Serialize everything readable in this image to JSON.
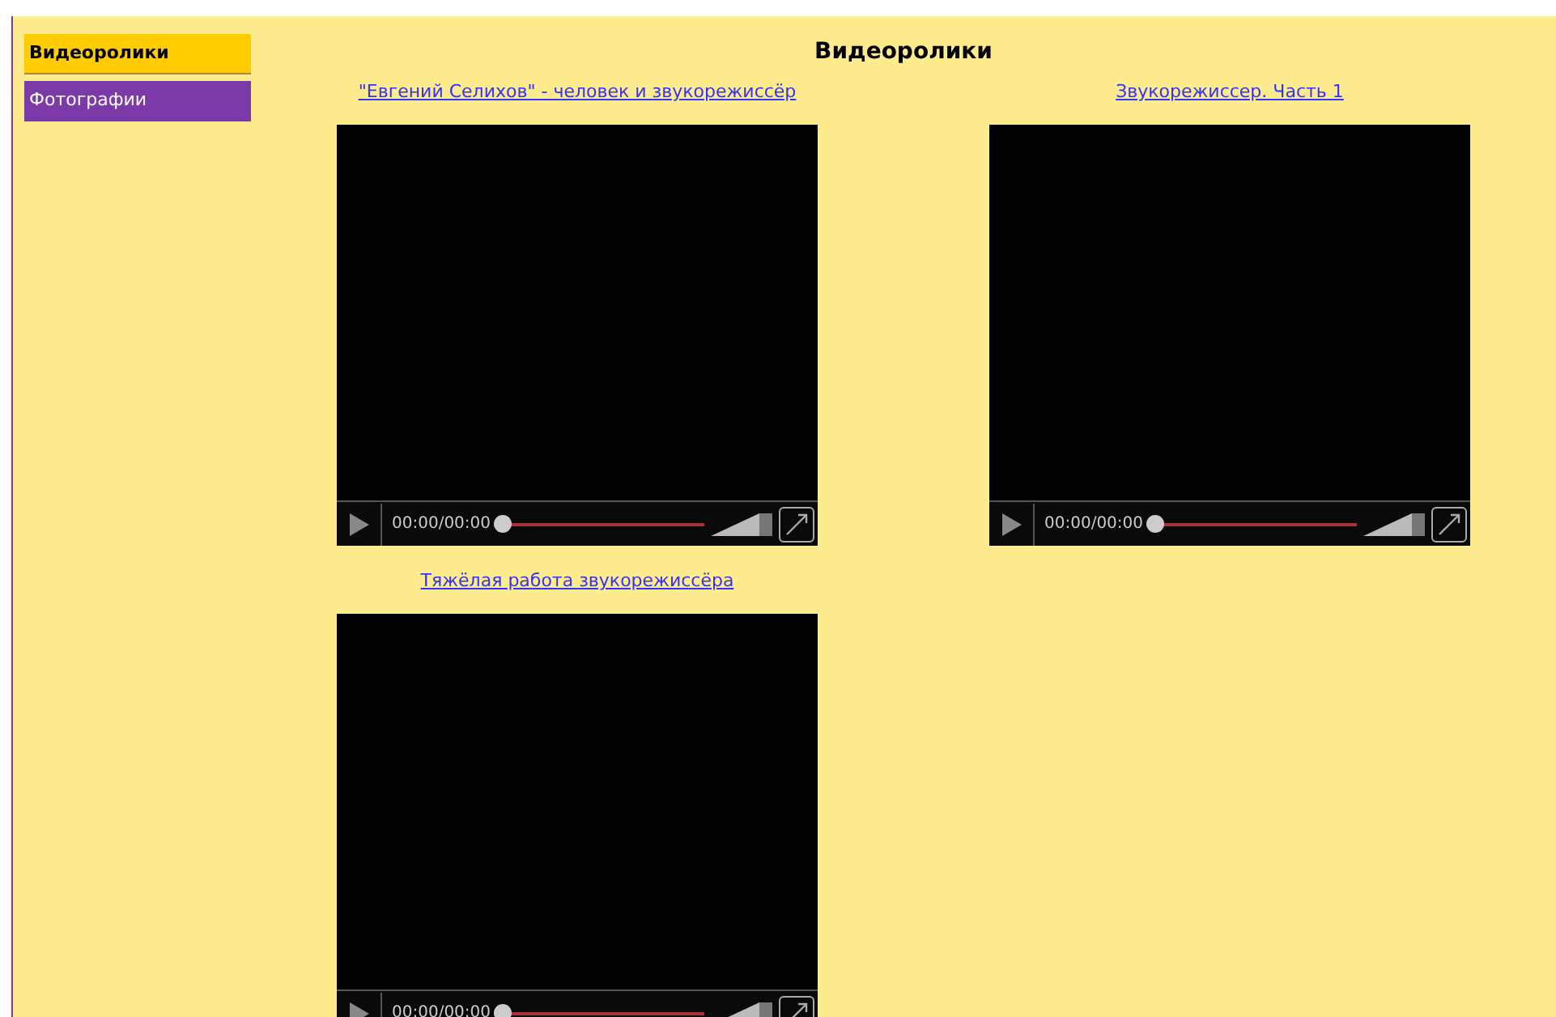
{
  "sidebar": {
    "items": [
      {
        "label": "Видеоролики",
        "selected": true
      },
      {
        "label": "Фотографии",
        "selected": false
      }
    ]
  },
  "title": "Видеоролики",
  "videos": [
    {
      "link": "\"Евгений Селихов\" - человек и звукорежиссёр",
      "time": "00:00/00:00"
    },
    {
      "link": "Звукорежиссер. Часть 1",
      "time": "00:00/00:00"
    },
    {
      "link": "Тяжёлая работа звукорежиссёра",
      "time": "00:00/00:00"
    }
  ]
}
